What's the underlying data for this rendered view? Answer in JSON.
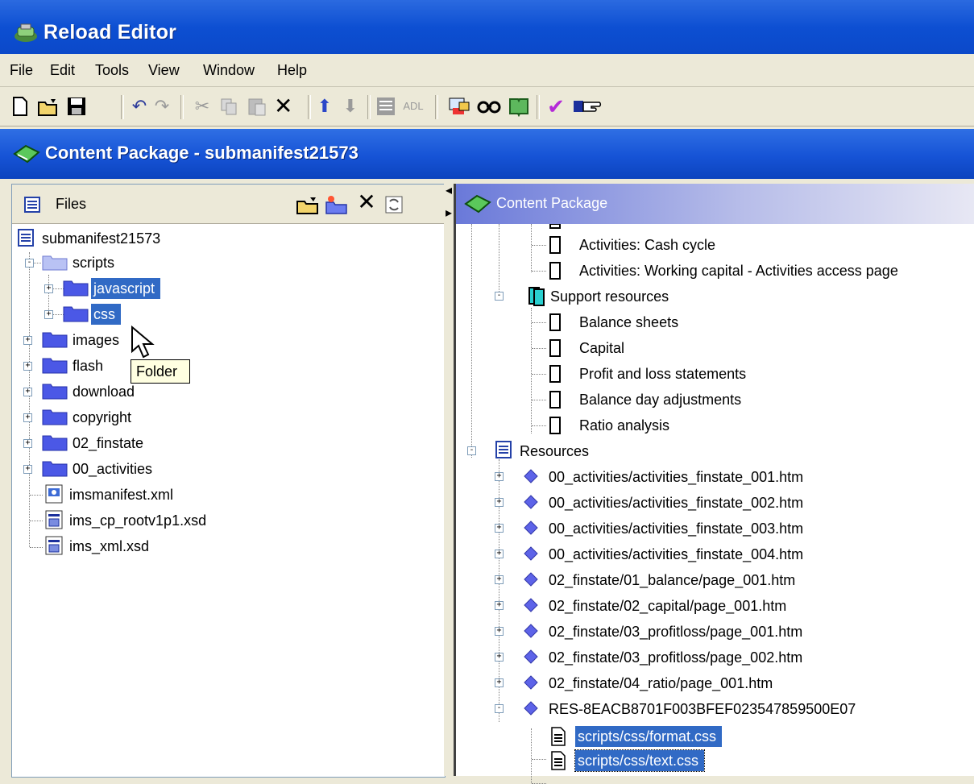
{
  "window": {
    "title": "Reload Editor"
  },
  "menu": [
    "File",
    "Edit",
    "Tools",
    "View",
    "Window",
    "Help"
  ],
  "toolbar": {
    "adl_label": "ADL"
  },
  "package_bar": {
    "title": "Content Package - submanifest21573"
  },
  "files_panel": {
    "header": "Files",
    "root": "submanifest21573",
    "items": [
      "scripts",
      "javascript",
      "css",
      "images",
      "flash",
      "download",
      "copyright",
      "02_finstate",
      "00_activities",
      "imsmanifest.xml",
      "ims_cp_rootv1p1.xsd",
      "ims_xml.xsd"
    ],
    "tooltip": "Folder"
  },
  "package_panel": {
    "header": "Content Package",
    "items": [
      "Activities: Cash cycle",
      "Activities: Working capital - Activities access page",
      "Support resources",
      "Balance sheets",
      "Capital",
      "Profit and loss statements",
      "Balance day adjustments",
      "Ratio analysis",
      "Resources",
      "00_activities/activities_finstate_001.htm",
      "00_activities/activities_finstate_002.htm",
      "00_activities/activities_finstate_003.htm",
      "00_activities/activities_finstate_004.htm",
      "02_finstate/01_balance/page_001.htm",
      "02_finstate/02_capital/page_001.htm",
      "02_finstate/03_profitloss/page_001.htm",
      "02_finstate/03_profitloss/page_002.htm",
      "02_finstate/04_ratio/page_001.htm",
      "RES-8EACB8701F003BFEF023547859500E07",
      "scripts/css/format.css",
      "scripts/css/text.css"
    ]
  }
}
